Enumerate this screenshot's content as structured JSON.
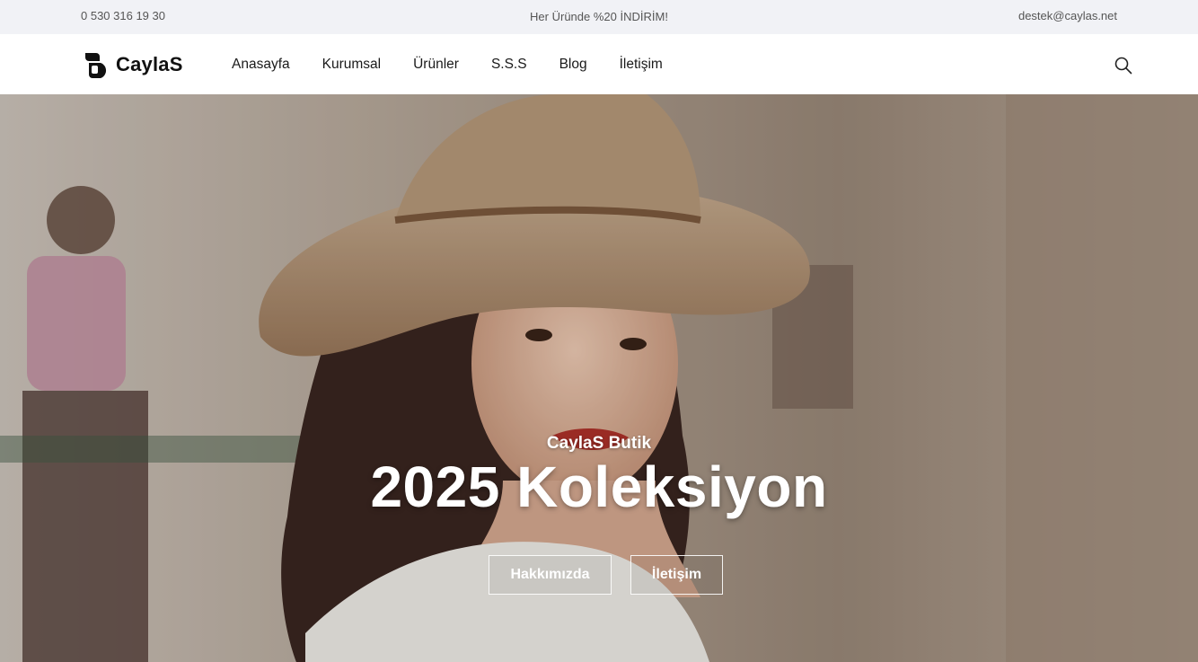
{
  "topbar": {
    "phone": "0 530 316 19 30",
    "promo": "Her Üründe %20 İNDİRİM!",
    "email": "destek@caylas.net"
  },
  "brand": {
    "name": "CaylaS",
    "logo_icon": "caylas-logo-icon"
  },
  "nav": {
    "items": [
      "Anasayfa",
      "Kurumsal",
      "Ürünler",
      "S.S.S",
      "Blog",
      "İletişim"
    ]
  },
  "search": {
    "icon": "search-icon"
  },
  "hero": {
    "tagline": "CaylaS Butik",
    "title": "2025 Koleksiyon",
    "buttons": {
      "about": "Hakkımızda",
      "contact": "İletişim"
    }
  },
  "colors": {
    "topbar_bg": "#f1f2f6",
    "header_bg": "#ffffff",
    "text_dark": "#1a1a1a",
    "hero_text": "#ffffff"
  }
}
